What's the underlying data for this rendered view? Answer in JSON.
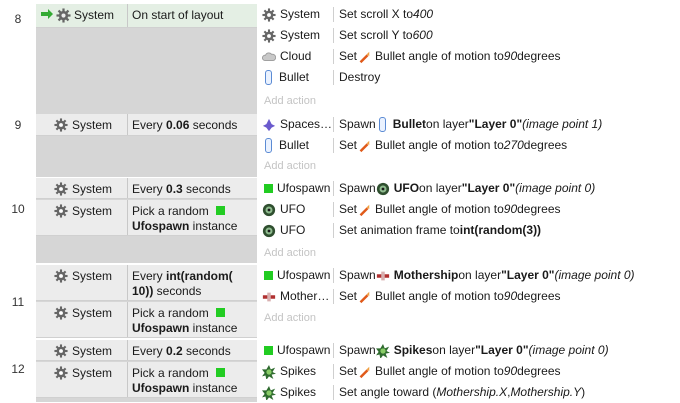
{
  "events": [
    {
      "number": "8",
      "conditions": [
        {
          "object": "System",
          "text": "On start of layout"
        }
      ],
      "actions": [
        {
          "object": "System",
          "icon": "gear-icon",
          "parts": [
            [
              "t",
              "Set scroll X to "
            ],
            [
              "i",
              "400"
            ]
          ]
        },
        {
          "object": "System",
          "icon": "gear-icon",
          "parts": [
            [
              "t",
              "Set scroll Y to "
            ],
            [
              "i",
              "600"
            ]
          ]
        },
        {
          "object": "Cloud",
          "icon": "cloud-icon",
          "parts": [
            [
              "t",
              "Set "
            ],
            [
              "ic",
              "bullet-behavior-icon"
            ],
            [
              "t",
              " Bullet angle of motion to "
            ],
            [
              "i",
              "90"
            ],
            [
              "t",
              " degrees"
            ]
          ]
        },
        {
          "object": "Bullet",
          "icon": "bullet-icon",
          "parts": [
            [
              "t",
              "Destroy"
            ]
          ]
        }
      ],
      "add_action": "Add action"
    },
    {
      "number": "9",
      "conditions": [
        {
          "object": "System",
          "text_parts": [
            [
              "t",
              "Every "
            ],
            [
              "b",
              "0.06"
            ],
            [
              "t",
              " seconds"
            ]
          ]
        }
      ],
      "actions": [
        {
          "object": "Spaces…",
          "icon": "spaceship-icon",
          "parts": [
            [
              "t",
              "Spawn "
            ],
            [
              "ic",
              "bullet-icon"
            ],
            [
              "b",
              "Bullet"
            ],
            [
              "t",
              " on layer "
            ],
            [
              "b",
              "\"Layer 0\""
            ],
            [
              "t",
              " "
            ],
            [
              "i",
              "(image point 1)"
            ]
          ]
        },
        {
          "object": "Bullet",
          "icon": "bullet-icon",
          "parts": [
            [
              "t",
              "Set "
            ],
            [
              "ic",
              "bullet-behavior-icon"
            ],
            [
              "t",
              " Bullet angle of motion to "
            ],
            [
              "i",
              "270"
            ],
            [
              "t",
              " degrees"
            ]
          ]
        }
      ],
      "add_action": "Add action"
    },
    {
      "number": "10",
      "conditions": [
        {
          "object": "System",
          "text_parts": [
            [
              "t",
              "Every "
            ],
            [
              "b",
              "0.3"
            ],
            [
              "t",
              " seconds"
            ]
          ]
        },
        {
          "object": "System",
          "text_parts": [
            [
              "t",
              "Pick a random "
            ],
            [
              "sq",
              ""
            ],
            [
              "br",
              ""
            ],
            [
              "b",
              "Ufospawn"
            ],
            [
              "t",
              " instance"
            ]
          ]
        }
      ],
      "actions": [
        {
          "object": "Ufospawn",
          "icon": "green-square-icon",
          "parts": [
            [
              "t",
              "Spawn "
            ],
            [
              "ic",
              "ufo-icon"
            ],
            [
              "b",
              "UFO"
            ],
            [
              "t",
              " on layer "
            ],
            [
              "b",
              "\"Layer 0\""
            ],
            [
              "t",
              " "
            ],
            [
              "i",
              "(image point 0)"
            ]
          ]
        },
        {
          "object": "UFO",
          "icon": "ufo-icon",
          "parts": [
            [
              "t",
              "Set "
            ],
            [
              "ic",
              "bullet-behavior-icon"
            ],
            [
              "t",
              " Bullet angle of motion to "
            ],
            [
              "i",
              "90"
            ],
            [
              "t",
              " degrees"
            ]
          ]
        },
        {
          "object": "UFO",
          "icon": "ufo-icon",
          "parts": [
            [
              "t",
              "Set animation frame to "
            ],
            [
              "b",
              "int(random(3))"
            ]
          ]
        }
      ],
      "add_action": "Add action"
    },
    {
      "number": "11",
      "conditions": [
        {
          "object": "System",
          "text_parts": [
            [
              "t",
              "Every "
            ],
            [
              "b",
              "int(random("
            ],
            [
              "br",
              ""
            ],
            [
              "b",
              "10))"
            ],
            [
              "t",
              " seconds"
            ]
          ]
        },
        {
          "object": "System",
          "text_parts": [
            [
              "t",
              "Pick a random "
            ],
            [
              "sq",
              ""
            ],
            [
              "br",
              ""
            ],
            [
              "b",
              "Ufospawn"
            ],
            [
              "t",
              " instance"
            ]
          ]
        }
      ],
      "actions": [
        {
          "object": "Ufospawn",
          "icon": "green-square-icon",
          "parts": [
            [
              "t",
              "Spawn "
            ],
            [
              "ic",
              "mothership-icon"
            ],
            [
              "b",
              "Mothership"
            ],
            [
              "t",
              " on layer "
            ],
            [
              "b",
              "\"Layer 0\""
            ],
            [
              "t",
              " "
            ],
            [
              "i",
              "(image point 0)"
            ]
          ]
        },
        {
          "object": "Mother…",
          "icon": "mothership-icon",
          "parts": [
            [
              "t",
              "Set "
            ],
            [
              "ic",
              "bullet-behavior-icon"
            ],
            [
              "t",
              " Bullet angle of motion to "
            ],
            [
              "i",
              "90"
            ],
            [
              "t",
              " degrees"
            ]
          ]
        }
      ],
      "add_action": "Add action"
    },
    {
      "number": "12",
      "conditions": [
        {
          "object": "System",
          "text_parts": [
            [
              "t",
              "Every "
            ],
            [
              "b",
              "0.2"
            ],
            [
              "t",
              " seconds"
            ]
          ]
        },
        {
          "object": "System",
          "text_parts": [
            [
              "t",
              "Pick a random "
            ],
            [
              "sq",
              ""
            ],
            [
              "br",
              ""
            ],
            [
              "b",
              "Ufospawn"
            ],
            [
              "t",
              " instance"
            ]
          ]
        }
      ],
      "actions": [
        {
          "object": "Ufospawn",
          "icon": "green-square-icon",
          "parts": [
            [
              "t",
              "Spawn "
            ],
            [
              "ic",
              "spikes-icon"
            ],
            [
              "b",
              "Spikes"
            ],
            [
              "t",
              " on layer "
            ],
            [
              "b",
              "\"Layer 0\""
            ],
            [
              "t",
              " "
            ],
            [
              "i",
              "(image point 0)"
            ]
          ]
        },
        {
          "object": "Spikes",
          "icon": "spikes-icon",
          "parts": [
            [
              "t",
              "Set "
            ],
            [
              "ic",
              "bullet-behavior-icon"
            ],
            [
              "t",
              " Bullet angle of motion to "
            ],
            [
              "i",
              "90"
            ],
            [
              "t",
              " degrees"
            ]
          ]
        },
        {
          "object": "Spikes",
          "icon": "spikes-icon",
          "parts": [
            [
              "t",
              "Set angle toward ("
            ],
            [
              "i",
              "Mothership.X"
            ],
            [
              "t",
              ", "
            ],
            [
              "i",
              "Mothership.Y"
            ],
            [
              "t",
              ")"
            ]
          ]
        }
      ]
    }
  ],
  "colors": {
    "condition_bg": "#ececec",
    "event_block_bg": "#d6d6d6",
    "add_action": "#c4c4c4",
    "arrow": "#22aa22"
  }
}
